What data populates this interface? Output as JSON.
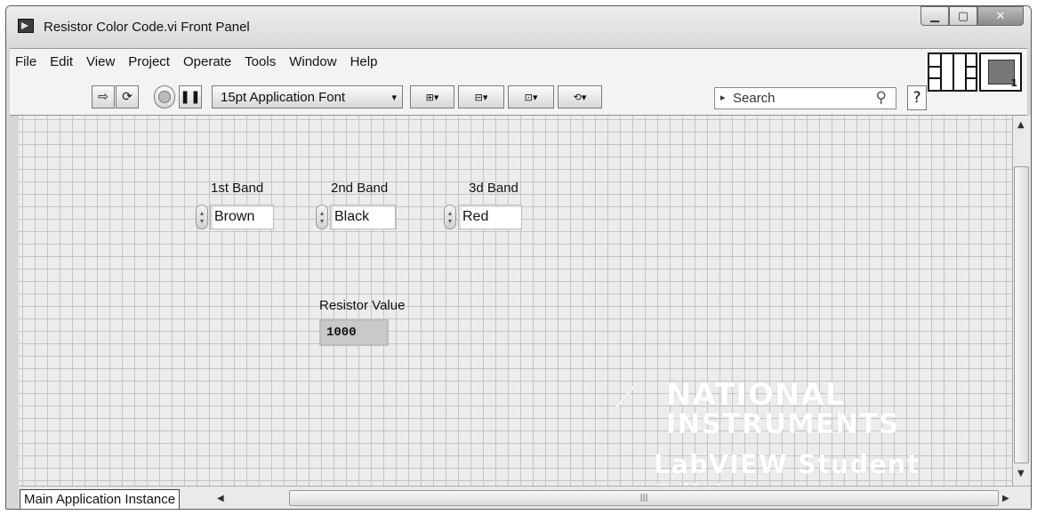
{
  "window": {
    "title": "Resistor Color Code.vi Front Panel"
  },
  "menu": [
    "File",
    "Edit",
    "View",
    "Project",
    "Operate",
    "Tools",
    "Window",
    "Help"
  ],
  "toolbar": {
    "font": "15pt Application Font",
    "search_placeholder": "Search"
  },
  "controls": {
    "band1": {
      "label": "1st Band",
      "value": "Brown"
    },
    "band2": {
      "label": "2nd Band",
      "value": "Black"
    },
    "band3": {
      "label": "3d Band",
      "value": "Red"
    }
  },
  "indicator": {
    "label": "Resistor Value",
    "value": "1000"
  },
  "watermark": {
    "line1": "NATIONAL",
    "line2": "INSTRUMENTS",
    "line3": "LabVIEW Student Edition"
  },
  "status": {
    "instance": "Main Application Instance"
  },
  "icon_names": [
    "labview-icon",
    "run-arrow-icon",
    "run-continuous-icon",
    "abort-icon",
    "pause-icon",
    "search-icon",
    "help-icon",
    "connector-pane-icon",
    "vi-icon"
  ]
}
